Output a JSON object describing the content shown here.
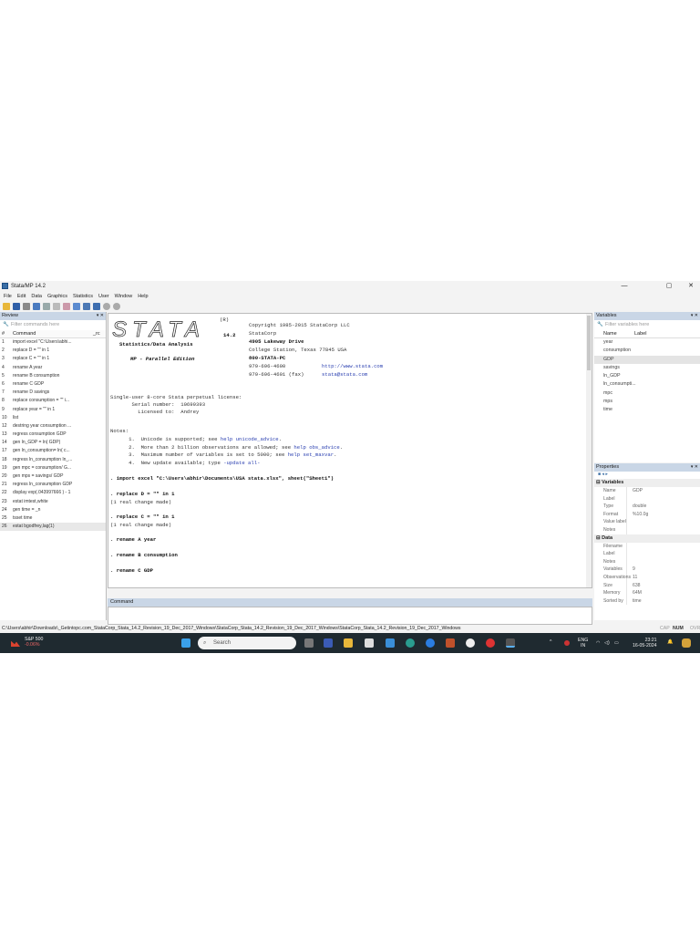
{
  "window": {
    "title": "Stata/MP 14.2",
    "minimize": "—",
    "maximize": "▢",
    "close": "✕"
  },
  "menu": [
    "File",
    "Edit",
    "Data",
    "Graphics",
    "Statistics",
    "User",
    "Window",
    "Help"
  ],
  "review": {
    "title": "Review",
    "pin": "▾ ✕",
    "filter_placeholder": "Filter commands here",
    "col_num": "#",
    "col_cmd": "Command",
    "col_rc": "_rc",
    "rows": [
      {
        "n": "1",
        "c": "import excel \"C:\\Users\\abhi..."
      },
      {
        "n": "2",
        "c": "replace D = \"\" in 1"
      },
      {
        "n": "3",
        "c": "replace C = \"\" in 1"
      },
      {
        "n": "4",
        "c": "rename A year"
      },
      {
        "n": "5",
        "c": "rename B consumption"
      },
      {
        "n": "6",
        "c": "rename C GDP"
      },
      {
        "n": "7",
        "c": "rename D savings"
      },
      {
        "n": "8",
        "c": "replace consumption = \"\" i..."
      },
      {
        "n": "9",
        "c": "replace year = \"\" in 1"
      },
      {
        "n": "10",
        "c": "list"
      },
      {
        "n": "12",
        "c": "destring year consumption ..."
      },
      {
        "n": "13",
        "c": "regress consumption GDP"
      },
      {
        "n": "14",
        "c": "gen ln_GDP = ln( GDP)"
      },
      {
        "n": "17",
        "c": "gen ln_consumption= ln( c..."
      },
      {
        "n": "18",
        "c": "regress ln_consumption ln_..."
      },
      {
        "n": "19",
        "c": "gen mpc = consumption/ G..."
      },
      {
        "n": "20",
        "c": "gen mps = savings/ GDP"
      },
      {
        "n": "21",
        "c": "regress ln_consumption GDP"
      },
      {
        "n": "22",
        "c": "display exp(.043997666 ) - 1"
      },
      {
        "n": "23",
        "c": "estat imtest,white"
      },
      {
        "n": "24",
        "c": "gen time = _n"
      },
      {
        "n": "25",
        "c": "tsset time"
      },
      {
        "n": "26",
        "c": "estat bgodfrey,lag(1)"
      }
    ]
  },
  "results": {
    "logo": "STATA",
    "reg": "(R)",
    "version": "14.2",
    "edition_sub": "Statistics/Data Analysis",
    "edition": "MP - Parallel Edition",
    "copyright": [
      "Copyright 1985-2015 StataCorp LLC",
      "StataCorp",
      "4905 Lakeway Drive",
      "College Station, Texas 77845 USA",
      "800-STATA-PC",
      "979-696-4600",
      "979-696-4601 (fax)"
    ],
    "web": "http://www.stata.com",
    "email": "stata@stata.com",
    "license": "Single-user 8-core Stata perpetual license:",
    "serial": "       Serial number:  10699393",
    "licensed": "         Licensed to:  Andrey",
    "notes_title": "Notes:",
    "notes": [
      {
        "pre": "      1.  Unicode is supported; see ",
        "link": "help unicode_advice",
        "post": "."
      },
      {
        "pre": "      2.  More than 2 billion observations are allowed; see ",
        "link": "help obs_advice",
        "post": "."
      },
      {
        "pre": "      3.  Maximum number of variables is set to 5000; see ",
        "link": "help set_maxvar",
        "post": "."
      },
      {
        "pre": "      4.  New update available; type ",
        "link": "-update all-",
        "post": ""
      }
    ],
    "log": [
      {
        "cmd": ". import excel \"C:\\Users\\abhir\\Documents\\USA stata.xlsx\", sheet(\"Sheet1\")",
        "out": ""
      },
      {
        "cmd": ". replace D = \"\" in 1",
        "out": "(1 real change made)"
      },
      {
        "cmd": ". replace C = \"\" in 1",
        "out": "(1 real change made)"
      },
      {
        "cmd": ". rename A year",
        "out": ""
      },
      {
        "cmd": ". rename B consumption",
        "out": ""
      },
      {
        "cmd": ". rename C GDP",
        "out": ""
      }
    ]
  },
  "command": {
    "label": "Command",
    "value": ""
  },
  "variables": {
    "title": "Variables",
    "filter_placeholder": "Filter variables here",
    "col_name": "Name",
    "col_label": "Label",
    "items": [
      "year",
      "consumption",
      "GDP",
      "savings",
      "ln_GDP",
      "ln_consumpti...",
      "mpc",
      "mps",
      "time"
    ],
    "selected": "GDP"
  },
  "properties": {
    "title": "Properties",
    "sec_vars": "Variables",
    "sec_data": "Data",
    "vars": [
      {
        "k": "Name",
        "v": "GDP"
      },
      {
        "k": "Label",
        "v": ""
      },
      {
        "k": "Type",
        "v": "double"
      },
      {
        "k": "Format",
        "v": "%10.0g"
      },
      {
        "k": "Value label",
        "v": ""
      },
      {
        "k": "Notes",
        "v": ""
      }
    ],
    "data": [
      {
        "k": "Filename",
        "v": ""
      },
      {
        "k": "Label",
        "v": ""
      },
      {
        "k": "Notes",
        "v": ""
      },
      {
        "k": "Variables",
        "v": "9"
      },
      {
        "k": "Observations",
        "v": "11"
      },
      {
        "k": "Size",
        "v": "638"
      },
      {
        "k": "Memory",
        "v": "64M"
      },
      {
        "k": "Sorted by",
        "v": "time"
      }
    ]
  },
  "status": {
    "path": "C:\\Users\\abhir\\Downloads\\_Getintopc.com_StataCorp_Stata_14.2_Revision_19_Dec_2017_Windows\\StataCorp_Stata_14.2_Revision_19_Dec_2017_Windows\\StataCorp_Stata_14.2_Revision_19_Dec_2017_Windows",
    "cap": "CAP",
    "num": "NUM",
    "ovr": "OVR"
  },
  "taskbar": {
    "stock_name": "S&P 500",
    "stock_change": "-0.06%",
    "search": "Search",
    "lang1": "ENG",
    "lang2": "IN",
    "time": "23:21",
    "date": "16-05-2024"
  }
}
